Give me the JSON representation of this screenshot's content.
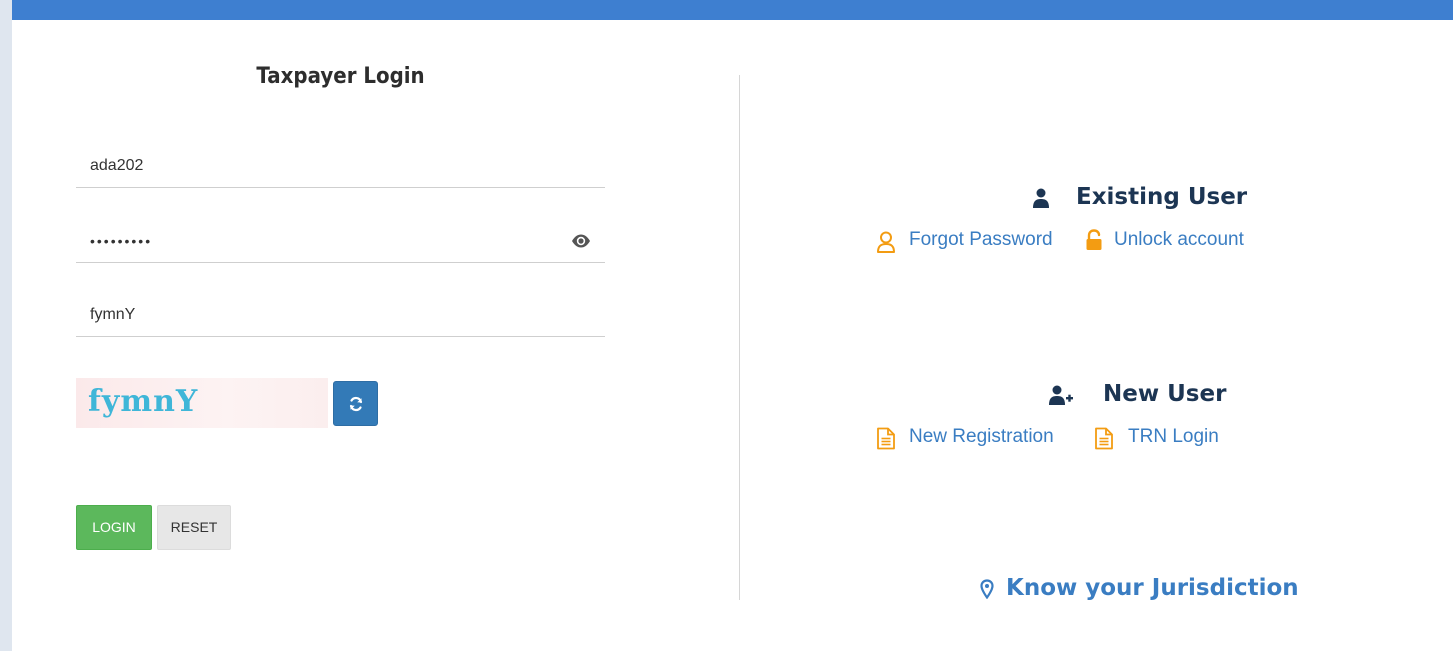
{
  "login": {
    "title": "Taxpayer Login",
    "username_value": "ada202",
    "password_value": "•••••••••",
    "captcha_input_value": "fymnY",
    "captcha_image_text": "fymnY",
    "login_label": "LOGIN",
    "reset_label": "RESET"
  },
  "existing_user": {
    "heading": "Existing User",
    "forgot_password": "Forgot Password",
    "unlock_account": "Unlock account"
  },
  "new_user": {
    "heading": "New User",
    "new_registration": "New Registration",
    "trn_login": "TRN Login"
  },
  "jurisdiction": {
    "label": "Know your Jurisdiction"
  },
  "colors": {
    "top_bar": "#3e7fd0",
    "login_button": "#5cb85c",
    "link": "#3a7dc2",
    "icon_orange": "#f39c12",
    "heading": "#1c3553"
  },
  "icons": {
    "password_toggle": "eye-icon",
    "captcha_refresh": "refresh-icon",
    "existing_user": "user-icon",
    "forgot_password": "user-outline-icon",
    "unlock_account": "unlock-icon",
    "new_user": "user-plus-icon",
    "new_registration": "document-icon",
    "trn_login": "document-icon",
    "jurisdiction": "map-marker-icon"
  }
}
